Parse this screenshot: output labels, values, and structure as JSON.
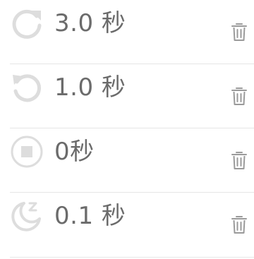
{
  "colors": {
    "icon": "#dddddd",
    "text": "#6b6b6b",
    "trash": "#9a9a9a",
    "divider": "#e6e6e6"
  },
  "rows": [
    {
      "label": "3.0 秒",
      "icon": "redo-icon"
    },
    {
      "label": "1.0 秒",
      "icon": "undo-icon"
    },
    {
      "label": "0秒",
      "icon": "stop-icon"
    },
    {
      "label": "0.1 秒",
      "icon": "sleep-moon-icon"
    }
  ]
}
